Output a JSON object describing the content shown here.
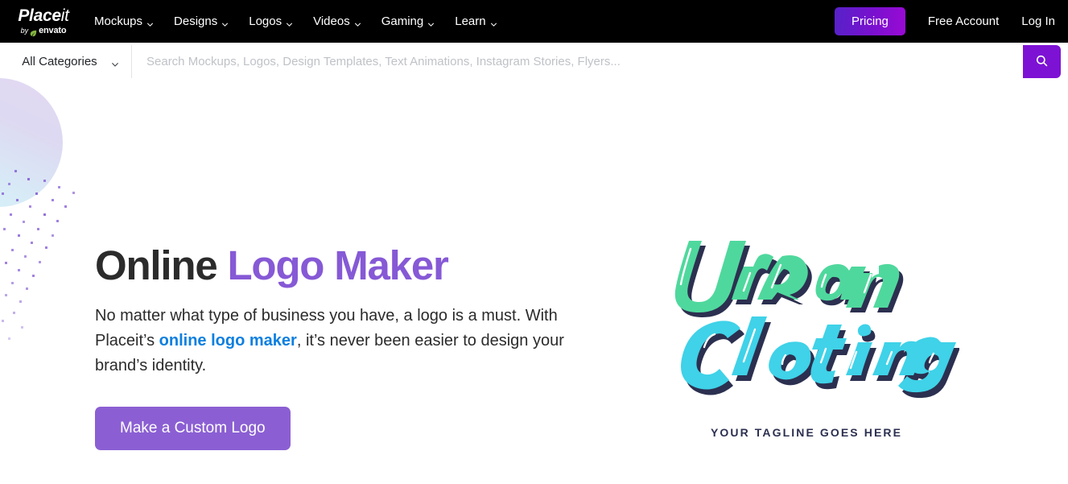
{
  "brand": {
    "name_bold": "Place",
    "name_light": "it",
    "by": "by",
    "envato": "envato",
    "leaf_icon": "leaf-icon"
  },
  "nav": {
    "items": [
      {
        "label": "Mockups",
        "icon": "chevron-down-icon"
      },
      {
        "label": "Designs",
        "icon": "chevron-down-icon"
      },
      {
        "label": "Logos",
        "icon": "chevron-down-icon"
      },
      {
        "label": "Videos",
        "icon": "chevron-down-icon"
      },
      {
        "label": "Gaming",
        "icon": "chevron-down-icon"
      },
      {
        "label": "Learn",
        "icon": "chevron-down-icon"
      }
    ],
    "pricing_label": "Pricing",
    "free_account_label": "Free Account",
    "login_label": "Log In"
  },
  "search": {
    "category_label": "All Categories",
    "category_icon": "chevron-down-icon",
    "placeholder": "Search Mockups, Logos, Design Templates, Text Animations, Instagram Stories, Flyers...",
    "value": "",
    "submit_icon": "search-icon"
  },
  "hero": {
    "title_plain": "Online ",
    "title_accent": "Logo Maker",
    "sub_part1": "No matter what type of business you have, a logo is a must. With Placeit’s ",
    "sub_link": "online logo maker",
    "sub_part2": ", it’s never been easier to design your brand’s identity.",
    "cta_label": "Make a Custom Logo"
  },
  "artwork": {
    "line1": "Urban",
    "line2": "Clothing",
    "tagline": "YOUR TAGLINE GOES HERE"
  },
  "colors": {
    "topbar_bg": "#000000",
    "pricing_gradient_start": "#5622c8",
    "pricing_gradient_end": "#9a0ad4",
    "search_button": "#7d12d4",
    "accent_purple": "#8659d6",
    "cta_purple": "#8b5fd3",
    "link_blue": "#0b7fe0",
    "logo_green": "#4fd89d",
    "logo_cyan": "#3fd2e8",
    "logo_navy": "#2c3050"
  }
}
